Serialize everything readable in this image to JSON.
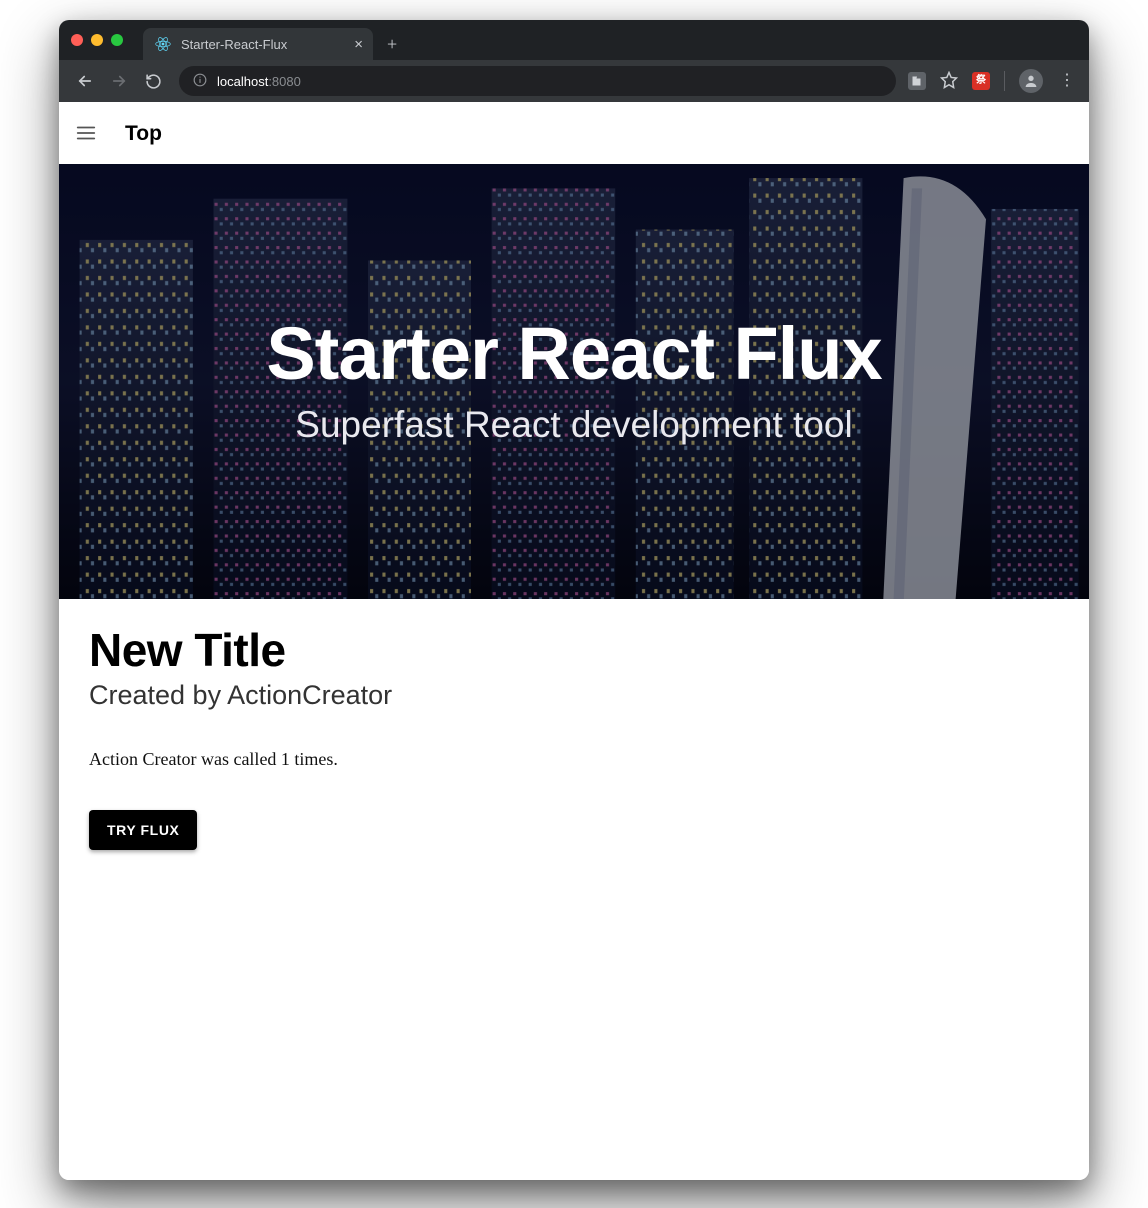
{
  "browser": {
    "tab_title": "Starter-React-Flux",
    "url_host": "localhost",
    "url_port": ":8080",
    "traffic_lights": [
      "close",
      "minimize",
      "zoom"
    ],
    "nav": {
      "back": "back",
      "forward": "forward",
      "reload": "reload"
    },
    "new_tab_glyph": "+",
    "close_tab_glyph": "×"
  },
  "appbar": {
    "title": "Top"
  },
  "hero": {
    "title": "Starter React Flux",
    "subtitle": "Superfast React development tool"
  },
  "section": {
    "heading": "New Title",
    "subheading": "Created by ActionCreator",
    "body": "Action Creator was called 1 times.",
    "button_label": "TRY FLUX"
  }
}
